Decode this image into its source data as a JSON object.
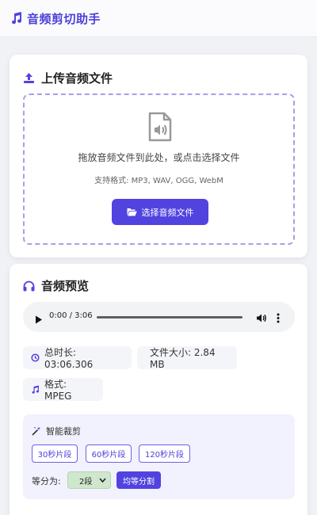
{
  "header": {
    "title": "音频剪切助手",
    "icon": "music-note-icon"
  },
  "upload": {
    "title": "上传音频文件",
    "drop_text": "拖放音频文件到此处，或点击选择文件",
    "formats_text": "支持格式: MP3, WAV, OGG, WebM",
    "button_label": "选择音频文件"
  },
  "preview": {
    "title": "音频预览",
    "player": {
      "time": "0:00 / 3:06",
      "progress": 0
    },
    "duration_label": "总时长: 03:06.306",
    "size_label": "文件大小: 2.84 MB",
    "format_label": "格式: MPEG",
    "smart": {
      "title": "智能裁剪",
      "segments": [
        "30秒片段",
        "60秒片段",
        "120秒片段"
      ],
      "divide_label": "等分为:",
      "select_value": "2段",
      "divide_button": "均等分割"
    }
  },
  "colors": {
    "accent": "#5143e0",
    "select_bg": "#cfe7cd",
    "smart_bg": "#f2f1fe"
  }
}
